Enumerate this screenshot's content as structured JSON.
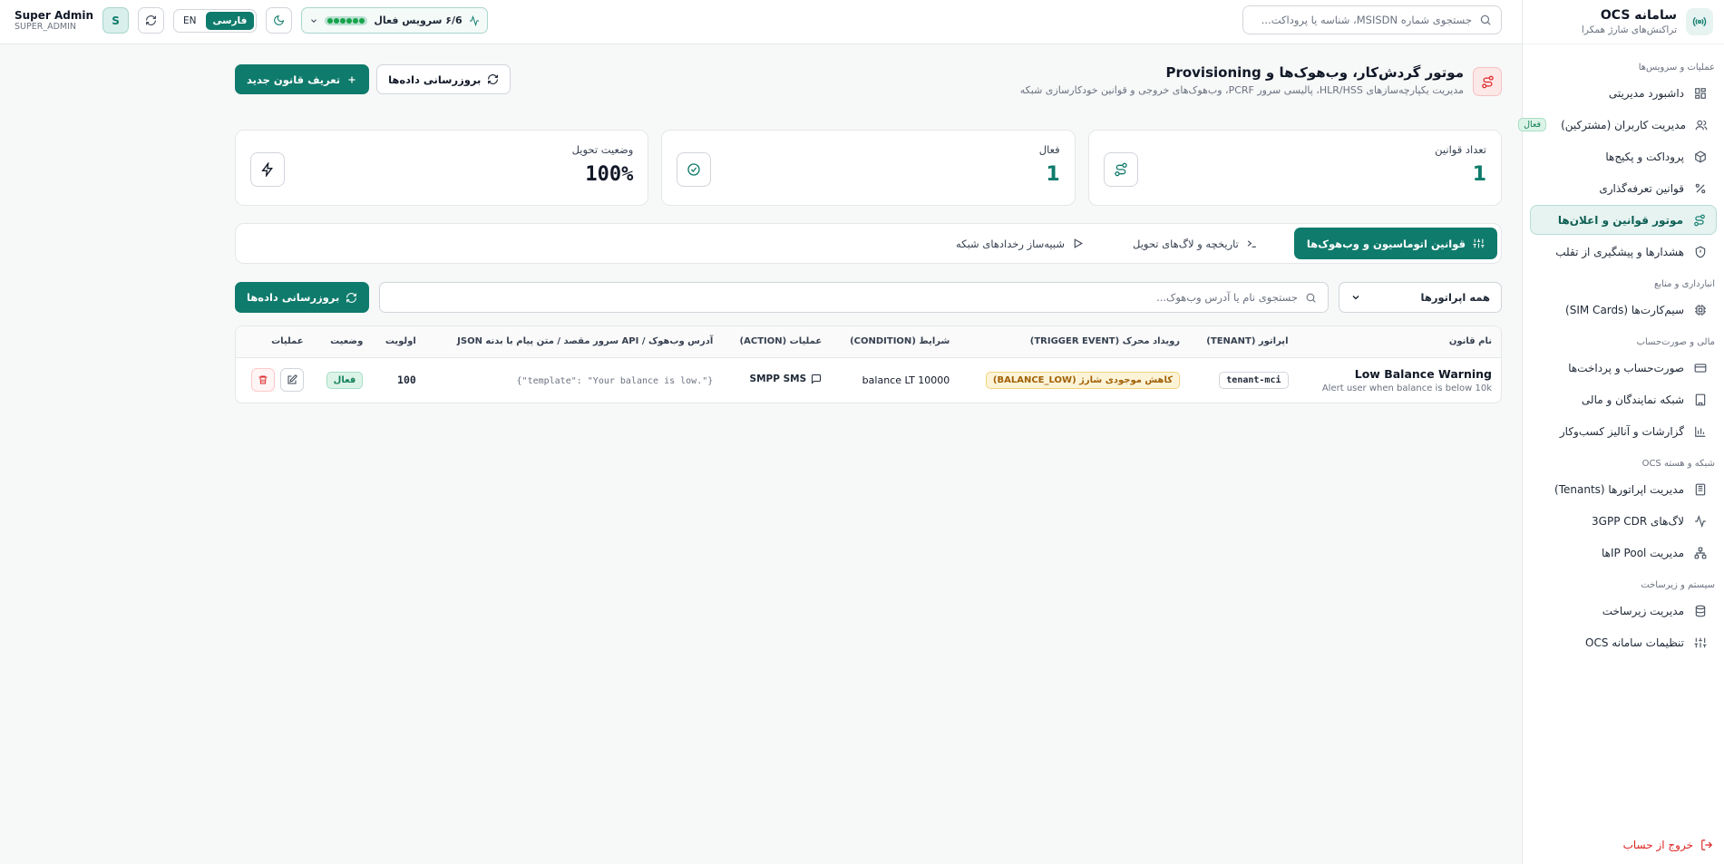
{
  "brand": {
    "title": "سامانه OCS",
    "subtitle": "تراکنش‌های شارژ همکرا"
  },
  "sidebar": {
    "sections": [
      {
        "title": "عملیات و سرویس‌ها",
        "items": [
          {
            "label": "داشبورد مدیریتی",
            "icon": "dashboard-icon"
          },
          {
            "label": "مدیریت کاربران (مشترکین)",
            "icon": "users-icon",
            "badge": "فعال"
          },
          {
            "label": "پروداکت و پکیج‌ها",
            "icon": "package-icon"
          },
          {
            "label": "قوانین تعرفه‌گذاری",
            "icon": "percent-icon"
          },
          {
            "label": "موتور قوانین و اعلان‌ها",
            "icon": "route-icon",
            "active": true
          },
          {
            "label": "هشدارها و پیشگیری از تقلب",
            "icon": "shield-icon"
          }
        ]
      },
      {
        "title": "انبارداری و منابع",
        "items": [
          {
            "label": "سیم‌کارت‌ها (SIM Cards)",
            "icon": "chip-icon"
          }
        ]
      },
      {
        "title": "مالی و صورت‌حساب",
        "items": [
          {
            "label": "صورت‌حساب و پرداخت‌ها",
            "icon": "card-icon"
          },
          {
            "label": "شبکه نمایندگان و مالی",
            "icon": "building-icon"
          },
          {
            "label": "گزارشات و آنالیز کسب‌وکار",
            "icon": "chart-icon"
          }
        ]
      },
      {
        "title": "شبکه و هسته OCS",
        "items": [
          {
            "label": "مدیریت اپراتورها (Tenants)",
            "icon": "server-icon"
          },
          {
            "label": "لاگ‌های 3GPP CDR",
            "icon": "activity-icon"
          },
          {
            "label": "مدیریت IP Poolها",
            "icon": "network-icon"
          }
        ]
      },
      {
        "title": "سیستم و زیرساخت",
        "items": [
          {
            "label": "مدیریت زیرساخت",
            "icon": "database-icon"
          },
          {
            "label": "تنظیمات سامانه OCS",
            "icon": "sliders-icon"
          }
        ]
      }
    ],
    "logout": "خروج از حساب"
  },
  "topbar": {
    "search_placeholder": "جستجوی شماره MSISDN، شناسه یا پروداکت...",
    "service_status": "۶/6 سرویس فعال",
    "lang_fa": "فارسی",
    "lang_en": "EN",
    "user_name": "Super Admin",
    "user_role": "SUPER_ADMIN",
    "avatar_letter": "S"
  },
  "page": {
    "title": "موتور گردش‌کار، وب‌هوک‌ها و Provisioning",
    "subtitle": "مدیریت یکپارچه‌سازهای HLR/HSS، پالیسی سرور PCRF، وب‌هوک‌های خروجی و قوانین خودکارسازی شبکه",
    "refresh_label": "بروزرسانی داده‌ها",
    "new_rule_label": "تعریف قانون جدید"
  },
  "stats": [
    {
      "label": "تعداد قوانین",
      "value": "1",
      "icon": "route-icon"
    },
    {
      "label": "فعال",
      "value": "1",
      "icon": "check-circle-icon"
    },
    {
      "label": "وضعیت تحویل",
      "value": "100%",
      "icon": "bolt-icon"
    }
  ],
  "tabs": [
    {
      "label": "قوانین اتوماسیون و وب‌هوک‌ها",
      "icon": "sliders-icon",
      "active": true
    },
    {
      "label": "تاریخچه و لاگ‌های تحویل",
      "icon": "terminal-icon"
    },
    {
      "label": "شبیه‌ساز رخدادهای شبکه",
      "icon": "play-icon"
    }
  ],
  "filters": {
    "operator_select": "همه اپراتورها",
    "search_placeholder": "جستجوی نام یا آدرس وب‌هوک...",
    "refresh_label": "بروزرسانی داده‌ها"
  },
  "table": {
    "headers": {
      "name": "نام قانون",
      "tenant": "اپراتور (TENANT)",
      "trigger": "رویداد محرک (TRIGGER EVENT)",
      "condition": "شرایط (CONDITION)",
      "action": "عملیات (ACTION)",
      "payload": "آدرس وب‌هوک / API سرور مقصد / متن پیام با بدنه JSON",
      "priority": "اولویت",
      "status": "وضعیت",
      "ops": "عملیات"
    },
    "rows": [
      {
        "name": "Low Balance Warning",
        "desc": "Alert user when balance is below 10k",
        "tenant": "tenant-mci",
        "trigger": "کاهش موجودی شارژ (BALANCE_LOW)",
        "condition": "balance LT 10000",
        "action": "SMPP SMS",
        "payload": "{\".template\": \"Your balance is low\"}",
        "priority": "100",
        "status": "فعال"
      }
    ]
  }
}
